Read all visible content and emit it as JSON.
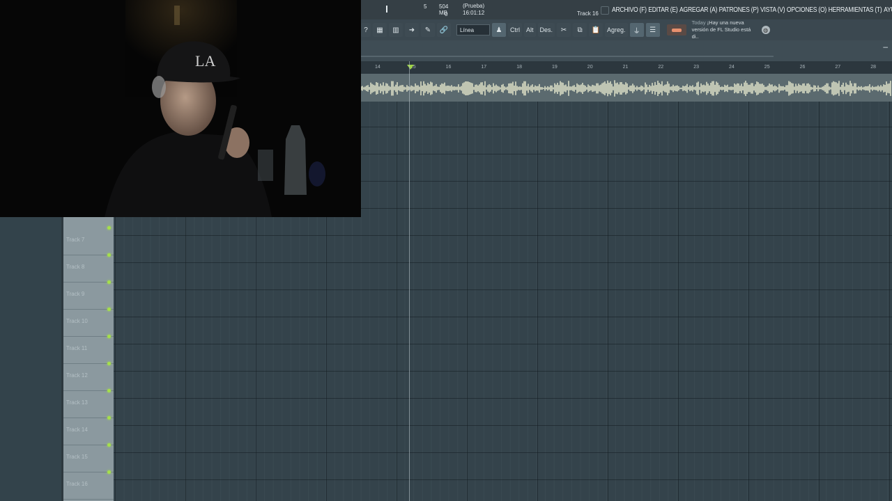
{
  "status": {
    "cpu_value": "5",
    "mem": "504 MB",
    "poly": "0",
    "project_name": "(Prueba)",
    "time": "16:01:12",
    "hint": "Track 16"
  },
  "menu": [
    "ARCHIVO (F)",
    "EDITAR (E)",
    "AGREGAR (A)",
    "PATRONES (P)",
    "VISTA (V)",
    "OPCIONES (O)",
    "HERRAMIENTAS (T)",
    "AYUDA"
  ],
  "toolbar": {
    "help": "?",
    "snap_label": "Línea",
    "ctrl": "Ctrl",
    "alt": "Alt",
    "des": "Des.",
    "agreg": "Agreg.",
    "news_today": "Today",
    "news_text": "¡Hay una nueva versión de FL Studio está di..",
    "meter_color": "#e7906e"
  },
  "ruler": {
    "marks": [
      {
        "label": "14"
      },
      {
        "label": "15"
      },
      {
        "label": "16"
      },
      {
        "label": "17"
      },
      {
        "label": "18"
      },
      {
        "label": "19"
      },
      {
        "label": "20"
      },
      {
        "label": "21"
      },
      {
        "label": "22"
      },
      {
        "label": "23"
      },
      {
        "label": "24"
      },
      {
        "label": "25"
      },
      {
        "label": "26"
      },
      {
        "label": "27"
      },
      {
        "label": "28"
      }
    ]
  },
  "tracks": [
    {
      "name": "Track 7"
    },
    {
      "name": "Track 8"
    },
    {
      "name": "Track 9"
    },
    {
      "name": "Track 10"
    },
    {
      "name": "Track 11"
    },
    {
      "name": "Track 12"
    },
    {
      "name": "Track 13"
    },
    {
      "name": "Track 14"
    },
    {
      "name": "Track 15"
    },
    {
      "name": "Track 16"
    }
  ],
  "colors": {
    "accent_led": "#a6e04a",
    "waveform": "#d9dcc4"
  },
  "webcam": {
    "cap_text": "LA"
  }
}
